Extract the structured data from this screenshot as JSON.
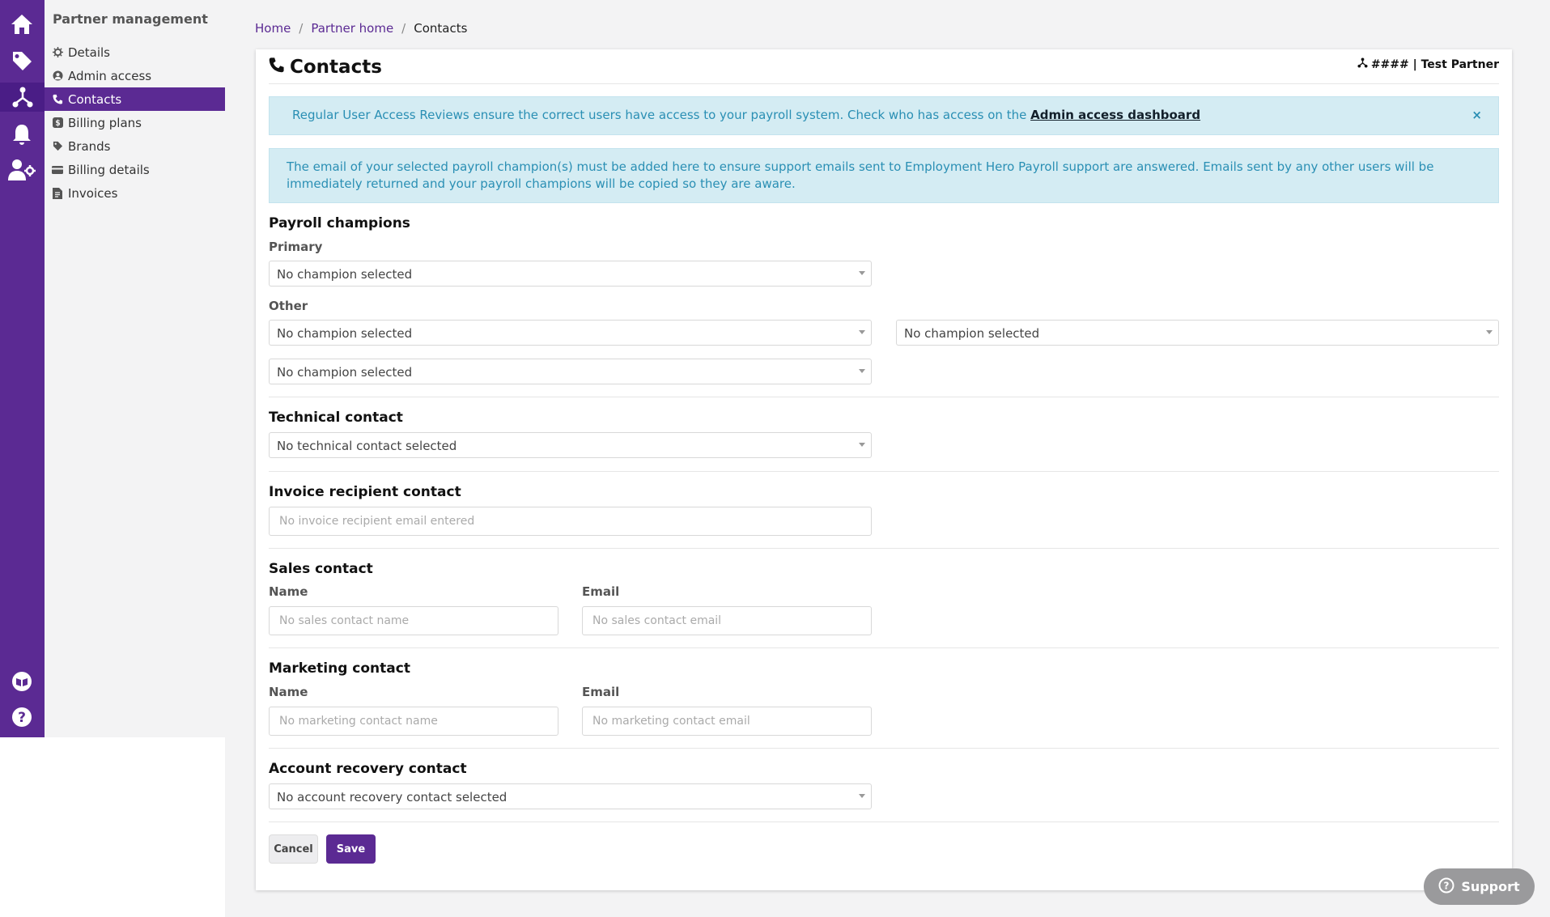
{
  "sidebar": {
    "title": "Partner management",
    "items": [
      {
        "label": "Details",
        "icon": "gear-icon"
      },
      {
        "label": "Admin access",
        "icon": "user-icon"
      },
      {
        "label": "Contacts",
        "icon": "phone-icon",
        "active": true
      },
      {
        "label": "Billing plans",
        "icon": "dollar-icon"
      },
      {
        "label": "Brands",
        "icon": "tag-icon"
      },
      {
        "label": "Billing details",
        "icon": "card-icon"
      },
      {
        "label": "Invoices",
        "icon": "document-icon"
      }
    ]
  },
  "rail": {
    "icons": [
      "home-icon",
      "tag-icon",
      "partner-network-icon",
      "bell-icon",
      "user-settings-icon",
      "book-icon",
      "help-icon"
    ]
  },
  "breadcrumb": {
    "home": "Home",
    "partner_home": "Partner home",
    "current": "Contacts",
    "separator": "/"
  },
  "header": {
    "title": "Contacts",
    "partner_label": "#### | Test Partner"
  },
  "alerts": {
    "access_review_text": "Regular User Access Reviews ensure the correct users have access to your payroll system. Check who has access on the",
    "access_review_link": "Admin access dashboard",
    "close": "×",
    "champion_notice": "The email of your selected payroll champion(s) must be added here to ensure support emails sent to Employment Hero Payroll support are answered. Emails sent by any other users will be immediately returned and your payroll champions will be copied so they are aware."
  },
  "payroll_champions": {
    "title": "Payroll champions",
    "primary_label": "Primary",
    "primary_value": "No champion selected",
    "other_label": "Other",
    "other_values": [
      "No champion selected",
      "No champion selected",
      "No champion selected"
    ]
  },
  "technical_contact": {
    "title": "Technical contact",
    "value": "No technical contact selected"
  },
  "invoice_recipient": {
    "title": "Invoice recipient contact",
    "placeholder": "No invoice recipient email entered"
  },
  "sales_contact": {
    "title": "Sales contact",
    "name_label": "Name",
    "email_label": "Email",
    "name_placeholder": "No sales contact name",
    "email_placeholder": "No sales contact email"
  },
  "marketing_contact": {
    "title": "Marketing contact",
    "name_label": "Name",
    "email_label": "Email",
    "name_placeholder": "No marketing contact name",
    "email_placeholder": "No marketing contact email"
  },
  "account_recovery": {
    "title": "Account recovery contact",
    "value": "No account recovery contact selected"
  },
  "actions": {
    "cancel": "Cancel",
    "save": "Save"
  },
  "support": {
    "label": "Support"
  },
  "colors": {
    "brand_purple": "#5b2a93",
    "info_bg": "#d4ecf3",
    "info_text": "#2a8fb4"
  }
}
